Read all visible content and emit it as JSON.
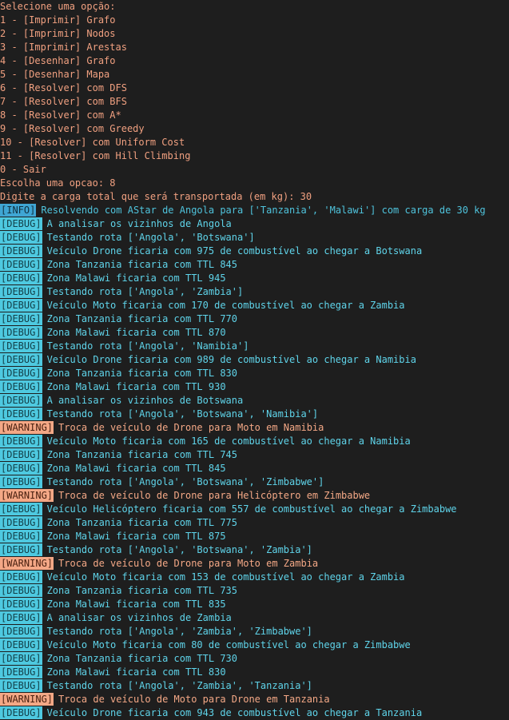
{
  "colors": {
    "background": "#1e1e1e",
    "menu_text": "#f0a080",
    "info": "#3fa6d4",
    "debug": "#4ec9e0",
    "warning": "#f4a886"
  },
  "menu": {
    "prompt": "Selecione uma opção:",
    "options": [
      "1 - [Imprimir] Grafo",
      "2 - [Imprimir] Nodos",
      "3 - [Imprimir] Arestas",
      "4 - [Desenhar] Grafo",
      "5 - [Desenhar] Mapa",
      "6 - [Resolver] com DFS",
      "7 - [Resolver] com BFS",
      "8 - [Resolver] com A*",
      "9 - [Resolver] com Greedy",
      "10 - [Resolver] com Uniform Cost",
      "11 - [Resolver] com Hill Climbing",
      "0 - Sair"
    ],
    "choice": "Escolha uma opcao: 8",
    "cargo_prompt": "Digite a carga total que será transportada (em kg): 30"
  },
  "log": [
    {
      "level": "INFO",
      "tag": "[INFO]",
      "message": "Resolvendo com AStar de Angola para ['Tanzania', 'Malawi'] com carga de 30 kg"
    },
    {
      "level": "DEBUG",
      "tag": "[DEBUG]",
      "message": "A analisar os vizinhos de Angola"
    },
    {
      "level": "DEBUG",
      "tag": "[DEBUG]",
      "message": "Testando rota ['Angola', 'Botswana']"
    },
    {
      "level": "DEBUG",
      "tag": "[DEBUG]",
      "message": "Veículo Drone ficaria com 975 de combustível ao chegar a Botswana"
    },
    {
      "level": "DEBUG",
      "tag": "[DEBUG]",
      "message": "Zona Tanzania ficaria com TTL 845"
    },
    {
      "level": "DEBUG",
      "tag": "[DEBUG]",
      "message": "Zona Malawi ficaria com TTL 945"
    },
    {
      "level": "DEBUG",
      "tag": "[DEBUG]",
      "message": "Testando rota ['Angola', 'Zambia']"
    },
    {
      "level": "DEBUG",
      "tag": "[DEBUG]",
      "message": "Veículo Moto ficaria com 170 de combustível ao chegar a Zambia"
    },
    {
      "level": "DEBUG",
      "tag": "[DEBUG]",
      "message": "Zona Tanzania ficaria com TTL 770"
    },
    {
      "level": "DEBUG",
      "tag": "[DEBUG]",
      "message": "Zona Malawi ficaria com TTL 870"
    },
    {
      "level": "DEBUG",
      "tag": "[DEBUG]",
      "message": "Testando rota ['Angola', 'Namibia']"
    },
    {
      "level": "DEBUG",
      "tag": "[DEBUG]",
      "message": "Veículo Drone ficaria com 989 de combustível ao chegar a Namibia"
    },
    {
      "level": "DEBUG",
      "tag": "[DEBUG]",
      "message": "Zona Tanzania ficaria com TTL 830"
    },
    {
      "level": "DEBUG",
      "tag": "[DEBUG]",
      "message": "Zona Malawi ficaria com TTL 930"
    },
    {
      "level": "DEBUG",
      "tag": "[DEBUG]",
      "message": "A analisar os vizinhos de Botswana"
    },
    {
      "level": "DEBUG",
      "tag": "[DEBUG]",
      "message": "Testando rota ['Angola', 'Botswana', 'Namibia']"
    },
    {
      "level": "WARNING",
      "tag": "[WARNING]",
      "message": "Troca de veículo de Drone para Moto em Namibia"
    },
    {
      "level": "DEBUG",
      "tag": "[DEBUG]",
      "message": "Veículo Moto ficaria com 165 de combustível ao chegar a Namibia"
    },
    {
      "level": "DEBUG",
      "tag": "[DEBUG]",
      "message": "Zona Tanzania ficaria com TTL 745"
    },
    {
      "level": "DEBUG",
      "tag": "[DEBUG]",
      "message": "Zona Malawi ficaria com TTL 845"
    },
    {
      "level": "DEBUG",
      "tag": "[DEBUG]",
      "message": "Testando rota ['Angola', 'Botswana', 'Zimbabwe']"
    },
    {
      "level": "WARNING",
      "tag": "[WARNING]",
      "message": "Troca de veículo de Drone para Helicóptero em Zimbabwe"
    },
    {
      "level": "DEBUG",
      "tag": "[DEBUG]",
      "message": "Veículo Helicóptero ficaria com 557 de combustível ao chegar a Zimbabwe"
    },
    {
      "level": "DEBUG",
      "tag": "[DEBUG]",
      "message": "Zona Tanzania ficaria com TTL 775"
    },
    {
      "level": "DEBUG",
      "tag": "[DEBUG]",
      "message": "Zona Malawi ficaria com TTL 875"
    },
    {
      "level": "DEBUG",
      "tag": "[DEBUG]",
      "message": "Testando rota ['Angola', 'Botswana', 'Zambia']"
    },
    {
      "level": "WARNING",
      "tag": "[WARNING]",
      "message": "Troca de veículo de Drone para Moto em Zambia"
    },
    {
      "level": "DEBUG",
      "tag": "[DEBUG]",
      "message": "Veículo Moto ficaria com 153 de combustível ao chegar a Zambia"
    },
    {
      "level": "DEBUG",
      "tag": "[DEBUG]",
      "message": "Zona Tanzania ficaria com TTL 735"
    },
    {
      "level": "DEBUG",
      "tag": "[DEBUG]",
      "message": "Zona Malawi ficaria com TTL 835"
    },
    {
      "level": "DEBUG",
      "tag": "[DEBUG]",
      "message": "A analisar os vizinhos de Zambia"
    },
    {
      "level": "DEBUG",
      "tag": "[DEBUG]",
      "message": "Testando rota ['Angola', 'Zambia', 'Zimbabwe']"
    },
    {
      "level": "DEBUG",
      "tag": "[DEBUG]",
      "message": "Veículo Moto ficaria com 80 de combustível ao chegar a Zimbabwe"
    },
    {
      "level": "DEBUG",
      "tag": "[DEBUG]",
      "message": "Zona Tanzania ficaria com TTL 730"
    },
    {
      "level": "DEBUG",
      "tag": "[DEBUG]",
      "message": "Zona Malawi ficaria com TTL 830"
    },
    {
      "level": "DEBUG",
      "tag": "[DEBUG]",
      "message": "Testando rota ['Angola', 'Zambia', 'Tanzania']"
    },
    {
      "level": "WARNING",
      "tag": "[WARNING]",
      "message": "Troca de veículo de Moto para Drone em Tanzania"
    },
    {
      "level": "DEBUG",
      "tag": "[DEBUG]",
      "message": "Veículo Drone ficaria com 943 de combustível ao chegar a Tanzania"
    }
  ]
}
